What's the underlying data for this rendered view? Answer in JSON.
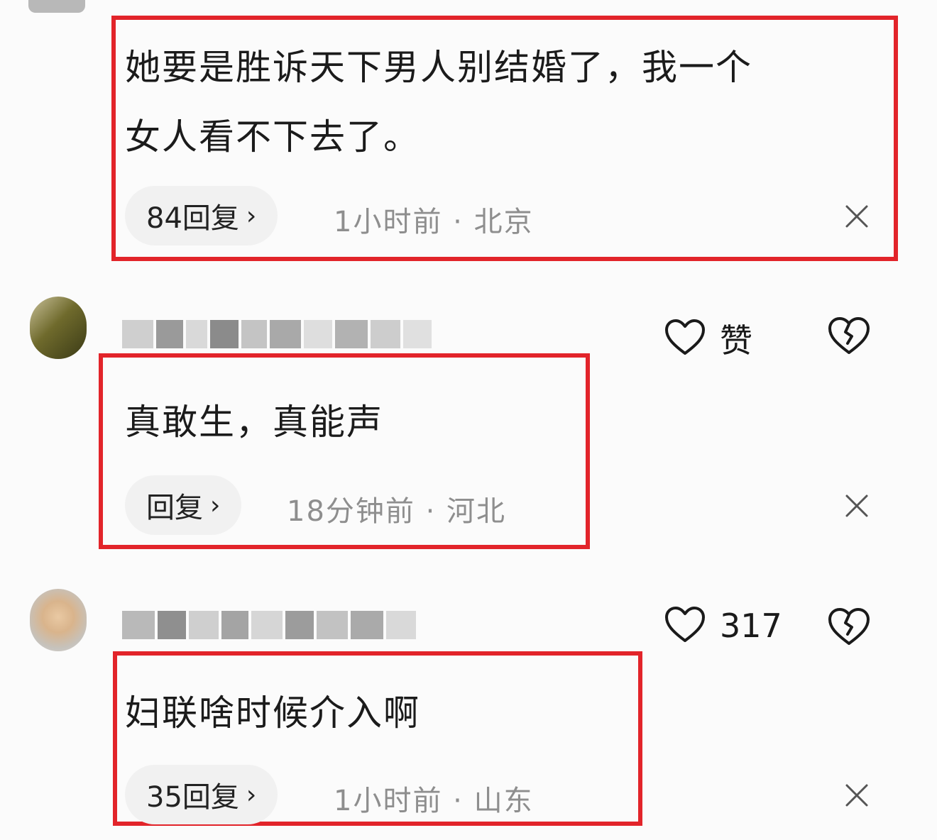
{
  "comments": [
    {
      "text_line1": "她要是胜诉天下男人别结婚了，我一个",
      "text_line2": "女人看不下去了。",
      "reply_label": "84回复",
      "meta": "1小时前 · 北京"
    },
    {
      "like_label": "赞",
      "text": "真敢生，真能声",
      "reply_label": "回复",
      "meta": "18分钟前 · 河北"
    },
    {
      "like_label": "317",
      "text": "妇联啥时候介入啊",
      "reply_label": "35回复",
      "meta": "1小时前 · 山东"
    }
  ],
  "colors": {
    "highlight_box": "#e2242a",
    "meta_text": "#8e8e8e",
    "pill_bg": "#f1f1f1"
  },
  "icons": {
    "like": "heart-outline-icon",
    "dislike": "broken-heart-icon",
    "close": "close-icon",
    "chevron": "chevron-right-icon"
  }
}
